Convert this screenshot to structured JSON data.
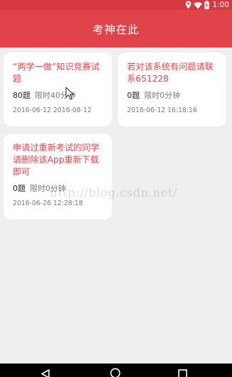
{
  "status_bar": {
    "time": "1:00"
  },
  "app_bar": {
    "title": "考神在此"
  },
  "exams": [
    {
      "title": "“两学一做”知识竞赛试题",
      "question_count": "80题",
      "time_limit": "限时40分钟",
      "dates": "2016-06-12 2016-08-12"
    },
    {
      "title": "若对该系统有问题请联系651228",
      "question_count": "0题",
      "time_limit": "限时0分钟",
      "dates": "2016-06-12 16:18:16"
    },
    {
      "title": "申请过重新考试的同学请删除该App重新下载即可",
      "question_count": "0题",
      "time_limit": "限时0分钟",
      "dates": "2016-06-26 12:28:18"
    }
  ],
  "watermark": "http://blog.csdn.net/",
  "nav_bar": {
    "buttons": [
      "back-icon",
      "home-icon",
      "recents-icon"
    ]
  },
  "colors": {
    "status_bar": "#d3393f",
    "app_bar": "#e0434a",
    "accent_text": "#e0434a",
    "background": "#efefef",
    "card": "#ffffff"
  }
}
